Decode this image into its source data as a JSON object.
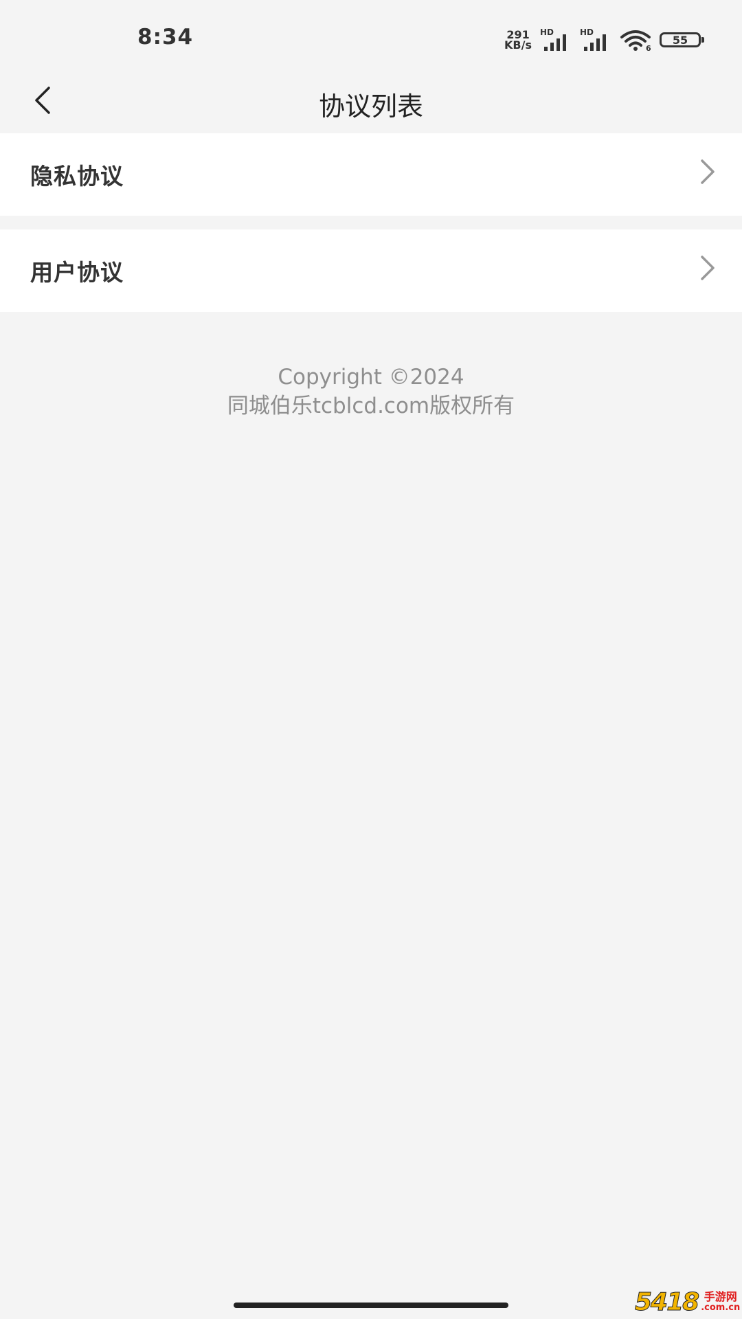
{
  "status_bar": {
    "time": "8:34",
    "net_speed_value": "291",
    "net_speed_unit": "KB/s",
    "signal_1_label": "HD",
    "signal_2_label": "HD",
    "battery_level": "55",
    "icons": [
      "signal-icon",
      "signal-icon",
      "wifi-icon",
      "battery-icon"
    ]
  },
  "nav": {
    "title": "协议列表",
    "back_icon": "back-chevron-icon"
  },
  "list": {
    "items": [
      {
        "label": "隐私协议",
        "icon": "chevron-right-icon"
      },
      {
        "label": "用户协议",
        "icon": "chevron-right-icon"
      }
    ]
  },
  "footer": {
    "line1": "Copyright ©2024",
    "line2": "同城伯乐tcblcd.com版权所有"
  },
  "watermark": {
    "number": "5418",
    "text_top": "手游网",
    "text_bottom": ".com.cn"
  },
  "colors": {
    "background": "#f4f4f4",
    "card": "#ffffff",
    "text_primary": "#222222",
    "text_secondary": "#8e8e8e",
    "chevron": "#999999"
  }
}
